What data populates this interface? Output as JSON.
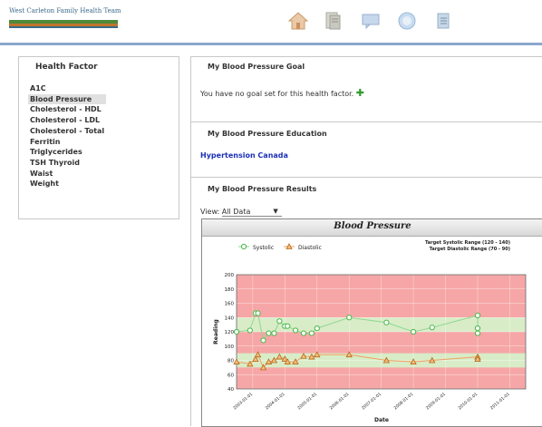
{
  "header": {
    "logo_text": "West Carleton Family Health Team",
    "nav_icons": [
      "home-icon",
      "document-icon",
      "message-icon",
      "help-icon",
      "notes-icon"
    ]
  },
  "sidebar": {
    "title": "Health Factor",
    "items": [
      {
        "label": "A1C",
        "selected": false
      },
      {
        "label": "Blood Pressure",
        "selected": true
      },
      {
        "label": "Cholesterol - HDL",
        "selected": false
      },
      {
        "label": "Cholesterol - LDL",
        "selected": false
      },
      {
        "label": "Cholesterol - Total",
        "selected": false
      },
      {
        "label": "Ferritin",
        "selected": false
      },
      {
        "label": "Triglycerides",
        "selected": false
      },
      {
        "label": "TSH Thyroid",
        "selected": false
      },
      {
        "label": "Waist",
        "selected": false
      },
      {
        "label": "Weight",
        "selected": false
      }
    ]
  },
  "goal": {
    "title": "My Blood Pressure Goal",
    "text": "You have no goal set for this health factor."
  },
  "education": {
    "title": "My Blood Pressure Education",
    "link": "Hypertension Canada"
  },
  "results": {
    "title": "My Blood Pressure Results",
    "view_label": "View:",
    "view_value": "All Data"
  },
  "colors": {
    "red_zone": "#f6a6a6",
    "green_zone": "#d8ecc8",
    "systolic": "#48b848",
    "diastolic": "#b86818",
    "systolic_line": "#8fd88f",
    "diastolic_line": "#f0a060"
  },
  "chart_data": {
    "type": "line",
    "title": "Blood Pressure",
    "xlabel": "Date",
    "ylabel": "Reading",
    "ylim": [
      40,
      200
    ],
    "xlim": [
      "2002-07-01",
      "2011-07-01"
    ],
    "yticks": [
      40,
      60,
      80,
      100,
      120,
      140,
      160,
      180,
      200
    ],
    "xticks": [
      "2003-01-01",
      "2004-01-01",
      "2005-01-01",
      "2006-01-01",
      "2007-01-01",
      "2008-01-01",
      "2009-01-01",
      "2010-01-01",
      "2011-01-01"
    ],
    "target_text": [
      "Target Systolic Range (120 - 140)",
      "Target Diastolic Range (70 - 90)"
    ],
    "bands": {
      "systolic_target": [
        120,
        140
      ],
      "diastolic_target": [
        70,
        90
      ]
    },
    "legend_position": "top",
    "series": [
      {
        "name": "Systolic",
        "marker": "circle",
        "x": [
          "2002-07-01",
          "2002-12-01",
          "2003-02-01",
          "2003-03-01",
          "2003-05-01",
          "2003-07-01",
          "2003-09-01",
          "2003-11-01",
          "2004-01-01",
          "2004-02-01",
          "2004-05-01",
          "2004-08-01",
          "2004-11-01",
          "2005-01-01",
          "2006-01-01",
          "2007-03-01",
          "2008-01-01",
          "2008-08-01",
          "2010-01-01",
          "2010-01-01",
          "2010-01-01"
        ],
        "values": [
          120,
          122,
          146,
          146,
          108,
          118,
          118,
          135,
          128,
          128,
          122,
          118,
          118,
          125,
          140,
          133,
          120,
          126,
          143,
          125,
          118
        ]
      },
      {
        "name": "Diastolic",
        "marker": "triangle",
        "x": [
          "2002-07-01",
          "2002-12-01",
          "2003-02-01",
          "2003-03-01",
          "2003-05-01",
          "2003-07-01",
          "2003-09-01",
          "2003-11-01",
          "2004-01-01",
          "2004-02-01",
          "2004-05-01",
          "2004-08-01",
          "2004-11-01",
          "2005-01-01",
          "2006-01-01",
          "2007-03-01",
          "2008-01-01",
          "2008-08-01",
          "2010-01-01",
          "2010-01-01"
        ],
        "values": [
          78,
          75,
          82,
          88,
          70,
          78,
          80,
          85,
          82,
          78,
          78,
          86,
          85,
          88,
          88,
          80,
          78,
          80,
          85,
          82
        ]
      }
    ]
  }
}
